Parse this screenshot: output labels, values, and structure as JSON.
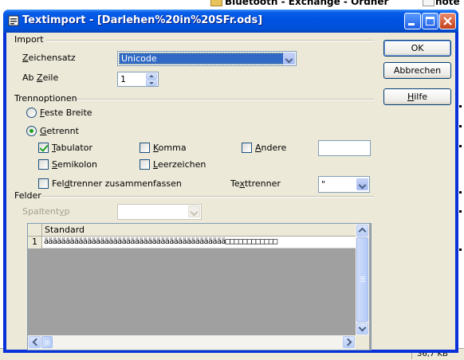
{
  "background": {
    "taskbar_text_1": "Bluetooth - Exchange - Ordner",
    "taskbar_text_2": "note",
    "status_size": "36,7 KB"
  },
  "window": {
    "title": "Textimport - [Darlehen%20in%20SFr.ods]"
  },
  "import": {
    "group_label": "Import",
    "charset_label": "Zeichensatz",
    "charset_value": "Unicode",
    "from_row_label": "Ab Zeile",
    "from_row_value": "1"
  },
  "buttons": {
    "ok": "OK",
    "cancel": "Abbrechen",
    "help": "Hilfe"
  },
  "separator_options": {
    "group_label": "Trennoptionen",
    "fixed_width": "Feste Breite",
    "separated": "Getrennt",
    "selected": "separated",
    "tab": {
      "label": "Tabulator",
      "checked": true
    },
    "comma": {
      "label": "Komma",
      "checked": false
    },
    "other": {
      "label": "Andere",
      "checked": false
    },
    "other_value": "",
    "semicolon": {
      "label": "Semikolon",
      "checked": false
    },
    "space": {
      "label": "Leerzeichen",
      "checked": false
    },
    "merge_delimiters": {
      "label": "Feldtrenner zusammenfassen",
      "checked": false
    },
    "text_delimiter_label": "Texttrenner",
    "text_delimiter_value": "\""
  },
  "fields": {
    "group_label": "Felder",
    "column_type_label": "Spaltentyp",
    "column_type_value": "",
    "preview": {
      "column_header": "Standard",
      "rows": [
        {
          "row_number": "1",
          "value": "ääääääääääääääääääääääääääääääääääääääääää□□□□□□□□□□□□"
        }
      ]
    }
  },
  "colors": {
    "title_bar": "#0054e3",
    "dialog_bg": "#ece9d8",
    "check_green": "#21a121"
  }
}
